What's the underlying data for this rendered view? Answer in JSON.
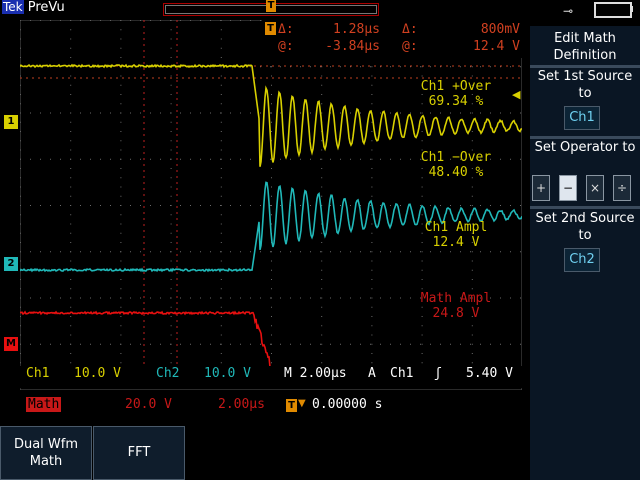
{
  "header": {
    "brand": "Tek",
    "mode": "PreVu"
  },
  "colors": {
    "ch1": "#d8d000",
    "ch2": "#20b8b8",
    "math": "#e81010",
    "menu_bg": "#0a1624"
  },
  "cursor_readout": {
    "delta_t_label": "Δ:",
    "delta_t": "1.28µs",
    "at_t_label": "@:",
    "at_t": "-3.84µs",
    "delta_v_label": "Δ:",
    "delta_v": "800mV",
    "at_v_label": "@:",
    "at_v": "12.4 V"
  },
  "measurements": [
    {
      "label": "Ch1 +Over",
      "value": "69.34 %",
      "color": "#d8d000"
    },
    {
      "label": "Ch1 −Over",
      "value": "48.40 %",
      "color": "#d8d000"
    },
    {
      "label": "Ch1 Ampl",
      "value": "12.4 V",
      "color": "#d8d000"
    },
    {
      "label": "Math Ampl",
      "value": "24.8 V",
      "color": "#c81818"
    }
  ],
  "channel_markers": {
    "ch1": "1",
    "ch2": "2",
    "math": "M"
  },
  "status": {
    "ch1_label": "Ch1",
    "ch1_scale": "10.0 V",
    "ch2_label": "Ch2",
    "ch2_scale": "10.0 V",
    "timebase": "M 2.00µs",
    "trigger_mode": "A",
    "trigger_source": "Ch1",
    "trigger_slope": "ʃ",
    "trigger_level": "5.40 V",
    "math_label": "Math",
    "math_scale": "20.0 V",
    "math_time": "2.00µs",
    "trigger_pos_icon": "T",
    "trigger_pos": "0.00000 s"
  },
  "menu": {
    "title": "Edit Math Definition",
    "set1_label": "Set 1st Source to",
    "set1_value": "Ch1",
    "operator_label": "Set Operator to",
    "operators": [
      "+",
      "−",
      "×",
      "÷"
    ],
    "selected_operator": "−",
    "set2_label": "Set 2nd Source to",
    "set2_value": "Ch2"
  },
  "bottom_menu": {
    "dual_wfm_math": "Dual Wfm Math",
    "fft": "FFT"
  }
}
